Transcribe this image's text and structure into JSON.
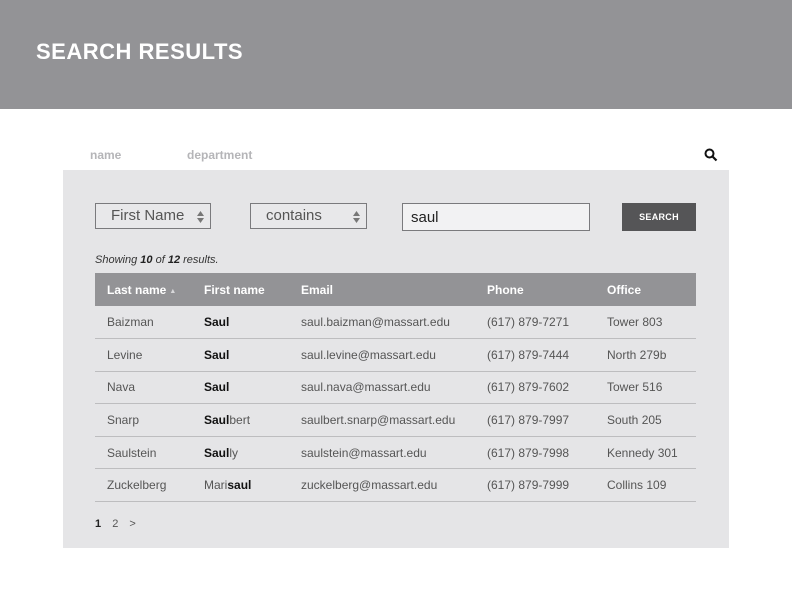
{
  "header": {
    "title": "SEARCH RESULTS"
  },
  "tabs": {
    "name": "name",
    "department": "department"
  },
  "search": {
    "field": "First Name",
    "operator": "contains",
    "query": "saul",
    "button_label": "SEARCH"
  },
  "results": {
    "prefix": "Showing",
    "shown": "10",
    "of": "of",
    "total": "12",
    "suffix": "results."
  },
  "table": {
    "headers": {
      "last": "Last name",
      "first": "First name",
      "email": "Email",
      "phone": "Phone",
      "office": "Office"
    },
    "rows": [
      {
        "last": "Baizman",
        "first_pre": "",
        "first_hl": "Saul",
        "first_post": "",
        "email": "saul.baizman@massart.edu",
        "phone": "(617) 879-7271",
        "office": "Tower 803"
      },
      {
        "last": "Levine",
        "first_pre": "",
        "first_hl": "Saul",
        "first_post": "",
        "email": "saul.levine@massart.edu",
        "phone": "(617) 879-7444",
        "office": "North 279b"
      },
      {
        "last": "Nava",
        "first_pre": "",
        "first_hl": "Saul",
        "first_post": "",
        "email": "saul.nava@massart.edu",
        "phone": "(617) 879-7602",
        "office": "Tower 516"
      },
      {
        "last": "Snarp",
        "first_pre": "",
        "first_hl": "Saul",
        "first_post": "bert",
        "email": "saulbert.snarp@massart.edu",
        "phone": "(617) 879-7997",
        "office": "South 205"
      },
      {
        "last": "Saulstein",
        "first_pre": "",
        "first_hl": "Saul",
        "first_post": "ly",
        "email": "saulstein@massart.edu",
        "phone": "(617) 879-7998",
        "office": "Kennedy 301"
      },
      {
        "last": "Zuckelberg",
        "first_pre": "Mari",
        "first_hl": "saul",
        "first_post": "",
        "email": "zuckelberg@massart.edu",
        "phone": "(617) 879-7999",
        "office": "Collins 109"
      }
    ]
  },
  "pagination": {
    "page1": "1",
    "page2": "2",
    "next": ">"
  }
}
